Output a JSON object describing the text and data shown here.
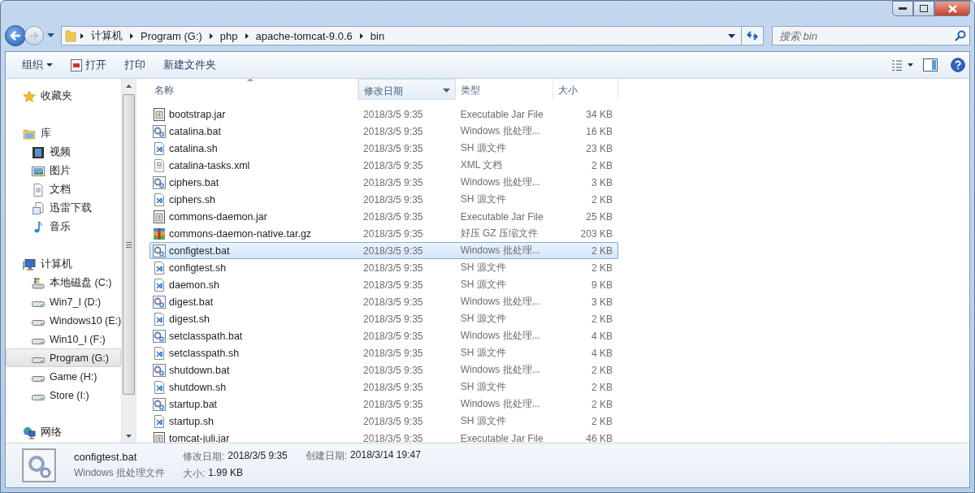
{
  "address": {
    "crumbs": [
      "计算机",
      "Program (G:)",
      "php",
      "apache-tomcat-9.0.6",
      "bin"
    ]
  },
  "search": {
    "placeholder": "搜索 bin"
  },
  "toolbar": {
    "buttons": [
      {
        "label": "组织",
        "kind": "menu"
      },
      {
        "label": "打开",
        "kind": "open"
      },
      {
        "label": "打印",
        "kind": "plain"
      },
      {
        "label": "新建文件夹",
        "kind": "plain"
      }
    ]
  },
  "sidebar": {
    "items": [
      {
        "label": "收藏夹",
        "kind": "star",
        "selected": false
      },
      {
        "label": "库",
        "kind": "library",
        "selected": false,
        "children": [
          {
            "label": "视频",
            "kind": "video",
            "selected": false
          },
          {
            "label": "图片",
            "kind": "picture",
            "selected": false
          },
          {
            "label": "文档",
            "kind": "document",
            "selected": false
          },
          {
            "label": "迅雷下载",
            "kind": "download",
            "selected": false
          },
          {
            "label": "音乐",
            "kind": "music",
            "selected": false
          }
        ]
      },
      {
        "label": "计算机",
        "kind": "computer",
        "selected": false,
        "children": [
          {
            "label": "本地磁盘 (C:)",
            "kind": "system-drive",
            "selected": false
          },
          {
            "label": "Win7_I (D:)",
            "kind": "drive",
            "selected": false
          },
          {
            "label": "Windows10 (E:)",
            "kind": "drive",
            "selected": false
          },
          {
            "label": "Win10_I (F:)",
            "kind": "drive",
            "selected": false
          },
          {
            "label": "Program (G:)",
            "kind": "drive",
            "selected": true
          },
          {
            "label": "Game (H:)",
            "kind": "drive",
            "selected": false
          },
          {
            "label": "Store (I:)",
            "kind": "drive",
            "selected": false
          }
        ]
      },
      {
        "label": "网络",
        "kind": "network",
        "selected": false
      }
    ]
  },
  "table": {
    "columns": [
      {
        "label": "名称",
        "sorted": true,
        "hot": false
      },
      {
        "label": "修改日期",
        "sorted": false,
        "hot": true
      },
      {
        "label": "类型",
        "sorted": false,
        "hot": false
      },
      {
        "label": "大小",
        "sorted": false,
        "hot": false
      }
    ],
    "rows": [
      {
        "name": "bootstrap.jar",
        "kind": "jar",
        "date": "2018/3/5 9:35",
        "type": "Executable Jar File",
        "size": "34 KB",
        "selected": false
      },
      {
        "name": "catalina.bat",
        "kind": "bat",
        "date": "2018/3/5 9:35",
        "type": "Windows 批处理...",
        "size": "16 KB",
        "selected": false
      },
      {
        "name": "catalina.sh",
        "kind": "sh",
        "date": "2018/3/5 9:35",
        "type": "SH 源文件",
        "size": "23 KB",
        "selected": false
      },
      {
        "name": "catalina-tasks.xml",
        "kind": "xml",
        "date": "2018/3/5 9:35",
        "type": "XML 文档",
        "size": "2 KB",
        "selected": false
      },
      {
        "name": "ciphers.bat",
        "kind": "bat",
        "date": "2018/3/5 9:35",
        "type": "Windows 批处理...",
        "size": "3 KB",
        "selected": false
      },
      {
        "name": "ciphers.sh",
        "kind": "sh",
        "date": "2018/3/5 9:35",
        "type": "SH 源文件",
        "size": "2 KB",
        "selected": false
      },
      {
        "name": "commons-daemon.jar",
        "kind": "jar",
        "date": "2018/3/5 9:35",
        "type": "Executable Jar File",
        "size": "25 KB",
        "selected": false
      },
      {
        "name": "commons-daemon-native.tar.gz",
        "kind": "archive",
        "date": "2018/3/5 9:35",
        "type": "好压 GZ 压缩文件",
        "size": "203 KB",
        "selected": false
      },
      {
        "name": "configtest.bat",
        "kind": "bat",
        "date": "2018/3/5 9:35",
        "type": "Windows 批处理...",
        "size": "2 KB",
        "selected": true
      },
      {
        "name": "configtest.sh",
        "kind": "sh",
        "date": "2018/3/5 9:35",
        "type": "SH 源文件",
        "size": "2 KB",
        "selected": false
      },
      {
        "name": "daemon.sh",
        "kind": "sh",
        "date": "2018/3/5 9:35",
        "type": "SH 源文件",
        "size": "9 KB",
        "selected": false
      },
      {
        "name": "digest.bat",
        "kind": "bat",
        "date": "2018/3/5 9:35",
        "type": "Windows 批处理...",
        "size": "3 KB",
        "selected": false
      },
      {
        "name": "digest.sh",
        "kind": "sh",
        "date": "2018/3/5 9:35",
        "type": "SH 源文件",
        "size": "2 KB",
        "selected": false
      },
      {
        "name": "setclasspath.bat",
        "kind": "bat",
        "date": "2018/3/5 9:35",
        "type": "Windows 批处理...",
        "size": "4 KB",
        "selected": false
      },
      {
        "name": "setclasspath.sh",
        "kind": "sh",
        "date": "2018/3/5 9:35",
        "type": "SH 源文件",
        "size": "4 KB",
        "selected": false
      },
      {
        "name": "shutdown.bat",
        "kind": "bat",
        "date": "2018/3/5 9:35",
        "type": "Windows 批处理...",
        "size": "2 KB",
        "selected": false
      },
      {
        "name": "shutdown.sh",
        "kind": "sh",
        "date": "2018/3/5 9:35",
        "type": "SH 源文件",
        "size": "2 KB",
        "selected": false
      },
      {
        "name": "startup.bat",
        "kind": "bat",
        "date": "2018/3/5 9:35",
        "type": "Windows 批处理...",
        "size": "2 KB",
        "selected": false
      },
      {
        "name": "startup.sh",
        "kind": "sh",
        "date": "2018/3/5 9:35",
        "type": "SH 源文件",
        "size": "2 KB",
        "selected": false
      },
      {
        "name": "tomcat-juli.jar",
        "kind": "jar",
        "date": "2018/3/5 9:35",
        "type": "Executable Jar File",
        "size": "46 KB",
        "selected": false
      }
    ]
  },
  "details": {
    "name": "configtest.bat",
    "type": "Windows 批处理文件",
    "fields": [
      {
        "label": "修改日期:",
        "value": "2018/3/5 9:35"
      },
      {
        "label": "大小:",
        "value": "1.99 KB"
      },
      {
        "label": "创建日期:",
        "value": "2018/3/14 19:47"
      }
    ]
  }
}
